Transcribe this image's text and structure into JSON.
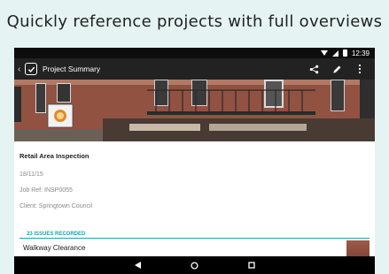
{
  "promo": {
    "headline": "Quickly reference projects with full overviews"
  },
  "status_bar": {
    "time": "12:39",
    "icons": [
      "wifi-icon",
      "signal-icon",
      "battery-icon"
    ]
  },
  "app_bar": {
    "title": "Project Summary",
    "actions": [
      "share-icon",
      "edit-icon",
      "more-vert-icon"
    ]
  },
  "project": {
    "title": "Retail Area Inspection",
    "date": "18/11/15",
    "job_ref": "Job Ref: INSP0055",
    "client": "Client: Springtown Council"
  },
  "issues": {
    "header": "23 ISSUES RECORDED",
    "first_issue_title": "Walkway Clearance"
  },
  "nav_bar": {
    "buttons": [
      "back-icon",
      "home-icon",
      "recents-icon"
    ]
  },
  "colors": {
    "accent": "#1fa3a8",
    "appbar": "#222222",
    "background": "#e6f3f3"
  }
}
